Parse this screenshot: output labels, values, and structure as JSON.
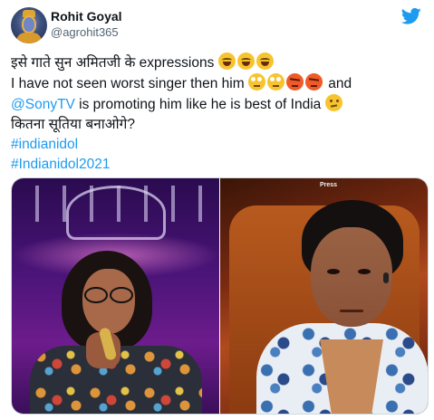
{
  "tweet": {
    "user_name": "Rohit Goyal",
    "user_handle": "@agrohit365",
    "lines": {
      "line1": "इसे गाते सुन अमितजी के expressions",
      "line2_prefix": "I have not seen worst singer then him",
      "line2_suffix": "and",
      "line3_mention": "@SonyTV",
      "line3_rest": " is promoting him like he is best of India",
      "line4": "कितना सूतिया बनाओगे?",
      "hashtag1": "#indianidol",
      "hashtag2": "#Indianidol2021"
    },
    "press_label": "Press"
  },
  "icons": {
    "line1_emoji": [
      "joy",
      "joy",
      "joy"
    ],
    "line2_emoji": [
      "face-with-rolling-eyes",
      "face-with-rolling-eyes",
      "angry-face",
      "angry-face"
    ],
    "line3_emoji": [
      "confused-face"
    ],
    "brand": "twitter-bird"
  },
  "colors": {
    "link": "#1d9bf0",
    "text": "#0f1419",
    "handle": "#536471",
    "brand": "#1d9bf0"
  }
}
